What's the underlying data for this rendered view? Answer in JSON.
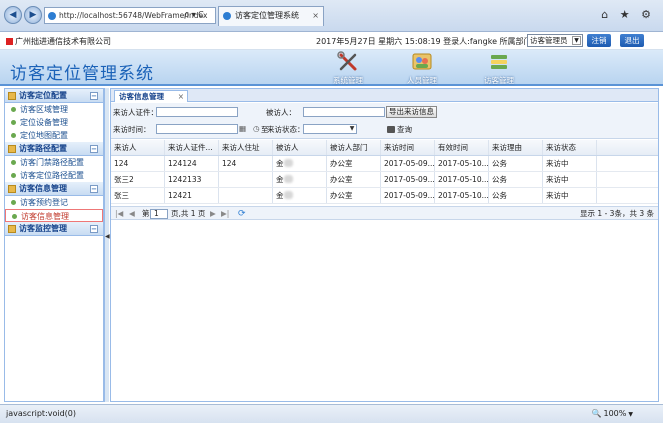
{
  "browser": {
    "url": "http://localhost:56748/WebFrame/Index",
    "addr_tools": "ρ ▾ C",
    "tab_title": "访客定位管理系统",
    "tab_close": "×",
    "right_icons": "⌂ ★ ⚙"
  },
  "topbar": {
    "company": "广州拙进通信技术有限公司",
    "user_info": "2017年5月27日 星期六 15:08:19 登录人:fangke 所属部门:角色",
    "role_select": "访客管理员",
    "logout": "注销",
    "exit": "退出"
  },
  "banner": {
    "title": "访客定位管理系统",
    "modules": [
      {
        "label": "系统管理",
        "icon": "tools-icon"
      },
      {
        "label": "人员管理",
        "icon": "people-icon"
      },
      {
        "label": "访客管理",
        "icon": "visitor-icon"
      }
    ]
  },
  "sidebar": {
    "toggle_symbol": "−",
    "sections": [
      {
        "title": "访客定位配置",
        "items": [
          "访客区域管理",
          "定位设备管理",
          "定位地图配置"
        ]
      },
      {
        "title": "访客路径配置",
        "items": [
          "访客门禁路径配置",
          "访客定位路径配置"
        ]
      },
      {
        "title": "访客信息管理",
        "items": [
          "访客预约登记",
          "访客信息管理"
        ]
      },
      {
        "title": "访客监控管理",
        "items": []
      }
    ]
  },
  "main": {
    "tab_label": "访客信息管理",
    "tab_close": "×",
    "form": {
      "cert_label": "来访人证件：",
      "visited_label": "被访人：",
      "export_button": "导出来访信息",
      "time_label": "来访时间：",
      "time_sep": "至",
      "status_label": "来访状态：",
      "query_button": "查询"
    },
    "table": {
      "columns": [
        "来访人",
        "来访人证件...",
        "来访人住址",
        "被访人",
        "被访人部门",
        "来访时间",
        "有效时间",
        "来访理由",
        "来访状态"
      ],
      "rows": [
        [
          "124",
          "124124",
          "124",
          "金",
          "办公室",
          "2017-05-09...",
          "2017-05-10...",
          "公务",
          "来访中"
        ],
        [
          "张三2",
          "1242133",
          "",
          "金",
          "办公室",
          "2017-05-09...",
          "2017-05-10...",
          "公务",
          "来访中"
        ],
        [
          "张三",
          "12421",
          "",
          "金",
          "办公室",
          "2017-05-09...",
          "2017-05-10...",
          "公务",
          "来访中"
        ]
      ]
    },
    "pager": {
      "nav_first": "|◀",
      "nav_prev": "◀",
      "page_prefix": "第",
      "page_input": "1",
      "page_suffix": "页,共 1 页",
      "nav_next": "▶",
      "nav_last": "▶|",
      "refresh": "⟳",
      "summary": "显示 1 - 3条，共 3 条"
    }
  },
  "statusbar": {
    "text": "javascript:void(0)",
    "zoom": "100%"
  },
  "colors": {
    "accent": "#1b62b8",
    "header_bg": "#dfe8f6",
    "active_item": "#c0392b"
  }
}
